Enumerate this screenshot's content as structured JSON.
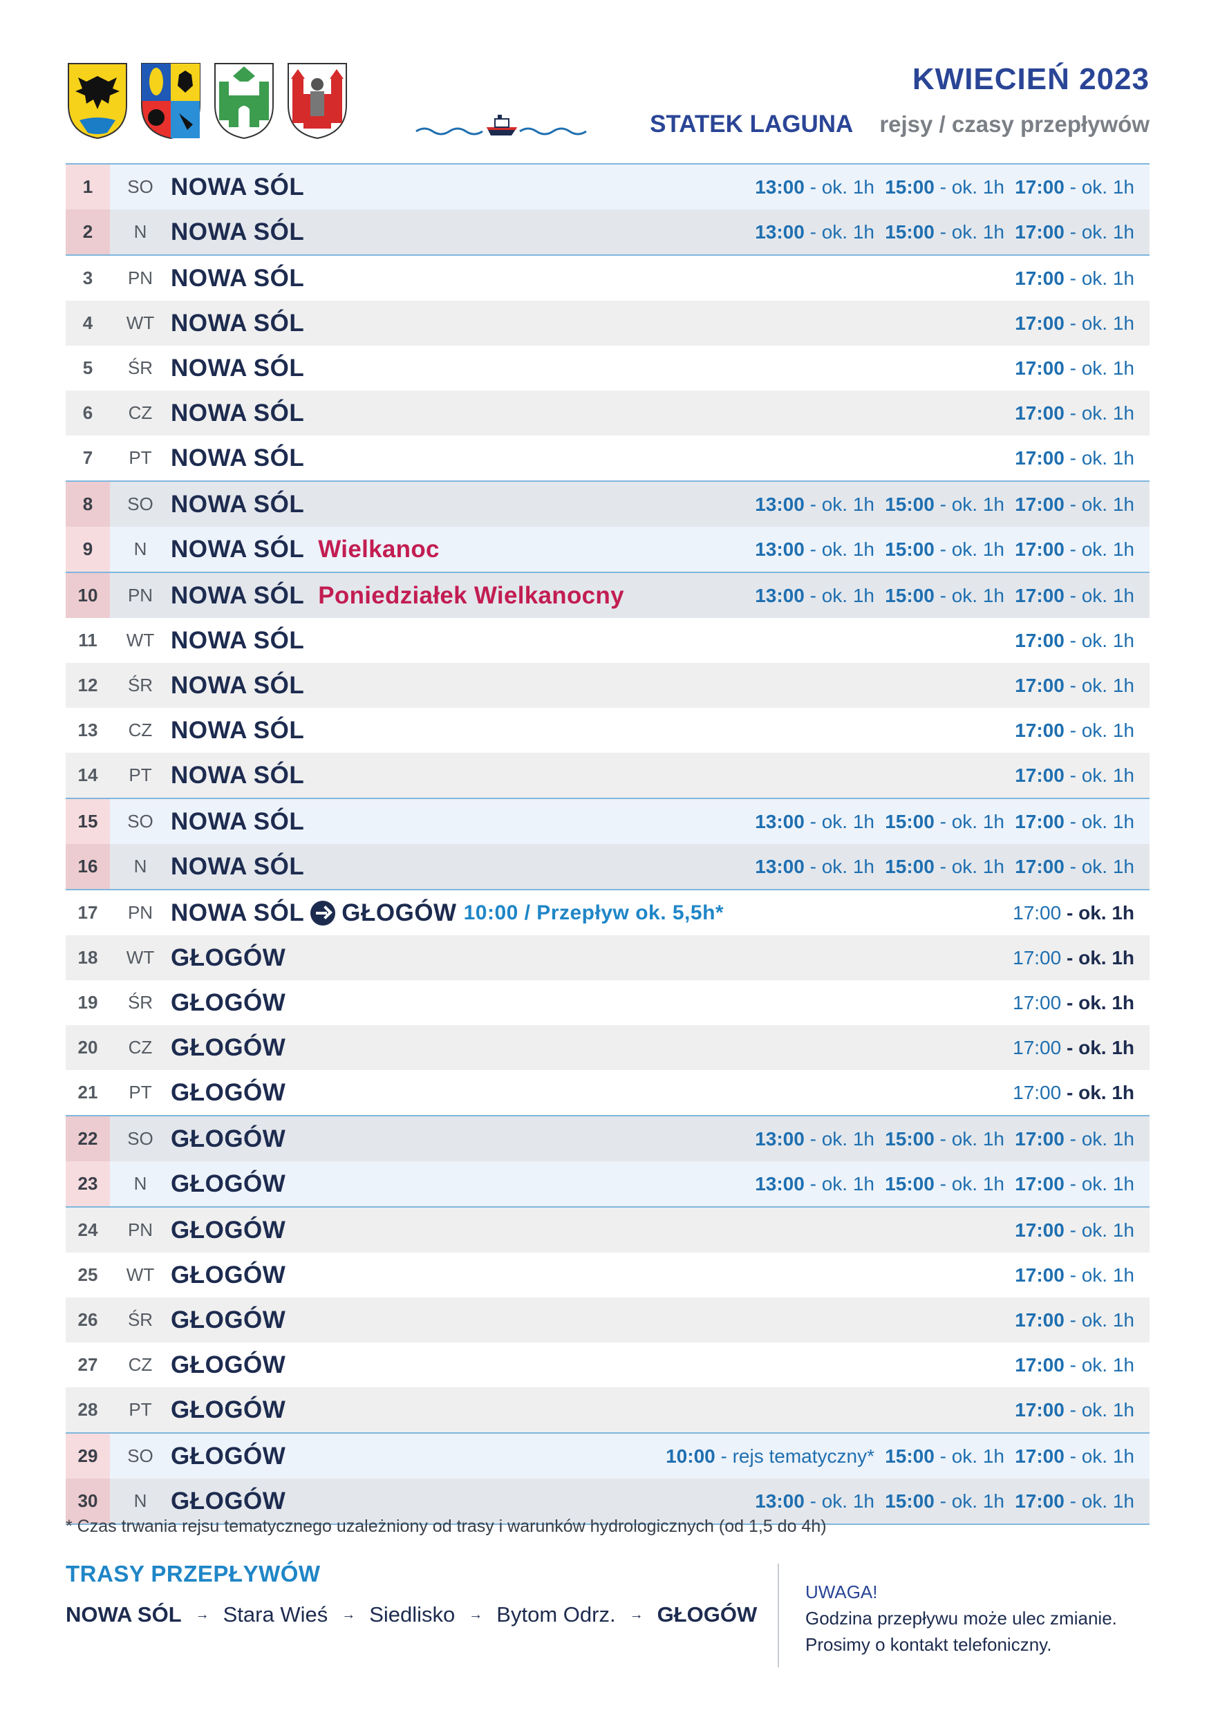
{
  "header": {
    "title": "KWIECIEŃ 2023",
    "ship": "STATEK LAGUNA",
    "subtitle": "rejsy / czasy przepływów"
  },
  "schedule": [
    {
      "day": "1",
      "dow": "SO",
      "place": "NOWA SÓL",
      "weekend": true,
      "times": [
        {
          "t": "13:00",
          "d": "- ok. 1h"
        },
        {
          "t": "15:00",
          "d": "- ok. 1h"
        },
        {
          "t": "17:00",
          "d": "- ok. 1h"
        }
      ]
    },
    {
      "day": "2",
      "dow": "N",
      "place": "NOWA SÓL",
      "weekend": true,
      "times": [
        {
          "t": "13:00",
          "d": "- ok. 1h"
        },
        {
          "t": "15:00",
          "d": "- ok. 1h"
        },
        {
          "t": "17:00",
          "d": "- ok. 1h"
        }
      ]
    },
    {
      "day": "3",
      "dow": "PN",
      "place": "NOWA SÓL",
      "times": [
        {
          "t": "17:00",
          "d": "- ok. 1h"
        }
      ]
    },
    {
      "day": "4",
      "dow": "WT",
      "place": "NOWA SÓL",
      "times": [
        {
          "t": "17:00",
          "d": "- ok. 1h"
        }
      ]
    },
    {
      "day": "5",
      "dow": "ŚR",
      "place": "NOWA SÓL",
      "times": [
        {
          "t": "17:00",
          "d": "- ok. 1h"
        }
      ]
    },
    {
      "day": "6",
      "dow": "CZ",
      "place": "NOWA SÓL",
      "times": [
        {
          "t": "17:00",
          "d": "- ok. 1h"
        }
      ]
    },
    {
      "day": "7",
      "dow": "PT",
      "place": "NOWA SÓL",
      "times": [
        {
          "t": "17:00",
          "d": "- ok. 1h"
        }
      ]
    },
    {
      "day": "8",
      "dow": "SO",
      "place": "NOWA SÓL",
      "weekend": true,
      "times": [
        {
          "t": "13:00",
          "d": "- ok. 1h"
        },
        {
          "t": "15:00",
          "d": "- ok. 1h"
        },
        {
          "t": "17:00",
          "d": "- ok. 1h"
        }
      ]
    },
    {
      "day": "9",
      "dow": "N",
      "place": "NOWA SÓL",
      "holiday": "Wielkanoc",
      "weekend": true,
      "times": [
        {
          "t": "13:00",
          "d": "- ok. 1h"
        },
        {
          "t": "15:00",
          "d": "- ok. 1h"
        },
        {
          "t": "17:00",
          "d": "- ok. 1h"
        }
      ]
    },
    {
      "day": "10",
      "dow": "PN",
      "place": "NOWA SÓL",
      "holiday": "Poniedziałek Wielkanocny",
      "weekend": true,
      "times": [
        {
          "t": "13:00",
          "d": "- ok. 1h"
        },
        {
          "t": "15:00",
          "d": "- ok. 1h"
        },
        {
          "t": "17:00",
          "d": "- ok. 1h"
        }
      ]
    },
    {
      "day": "11",
      "dow": "WT",
      "place": "NOWA SÓL",
      "times": [
        {
          "t": "17:00",
          "d": "- ok. 1h"
        }
      ]
    },
    {
      "day": "12",
      "dow": "ŚR",
      "place": "NOWA SÓL",
      "times": [
        {
          "t": "17:00",
          "d": "- ok. 1h"
        }
      ]
    },
    {
      "day": "13",
      "dow": "CZ",
      "place": "NOWA SÓL",
      "times": [
        {
          "t": "17:00",
          "d": "- ok. 1h"
        }
      ]
    },
    {
      "day": "14",
      "dow": "PT",
      "place": "NOWA SÓL",
      "times": [
        {
          "t": "17:00",
          "d": "- ok. 1h"
        }
      ]
    },
    {
      "day": "15",
      "dow": "SO",
      "place": "NOWA SÓL",
      "weekend": true,
      "times": [
        {
          "t": "13:00",
          "d": "- ok. 1h"
        },
        {
          "t": "15:00",
          "d": "- ok. 1h"
        },
        {
          "t": "17:00",
          "d": "- ok. 1h"
        }
      ]
    },
    {
      "day": "16",
      "dow": "N",
      "place": "NOWA SÓL",
      "weekend": true,
      "times": [
        {
          "t": "13:00",
          "d": "- ok. 1h"
        },
        {
          "t": "15:00",
          "d": "- ok. 1h"
        },
        {
          "t": "17:00",
          "d": "- ok. 1h"
        }
      ]
    },
    {
      "day": "17",
      "dow": "PN",
      "place": "NOWA SÓL",
      "destination": "GŁOGÓW",
      "transfer": "10:00 / Przepływ ok. 5,5h*",
      "times": [
        {
          "t": "17:00",
          "d": "- ok. 1h",
          "style": "bold-dur"
        }
      ]
    },
    {
      "day": "18",
      "dow": "WT",
      "place": "GŁOGÓW",
      "times": [
        {
          "t": "17:00",
          "d": "- ok. 1h",
          "style": "bold-dur"
        }
      ]
    },
    {
      "day": "19",
      "dow": "ŚR",
      "place": "GŁOGÓW",
      "times": [
        {
          "t": "17:00",
          "d": "- ok. 1h",
          "style": "bold-dur"
        }
      ]
    },
    {
      "day": "20",
      "dow": "CZ",
      "place": "GŁOGÓW",
      "times": [
        {
          "t": "17:00",
          "d": "- ok. 1h",
          "style": "bold-dur"
        }
      ]
    },
    {
      "day": "21",
      "dow": "PT",
      "place": "GŁOGÓW",
      "times": [
        {
          "t": "17:00",
          "d": "- ok. 1h",
          "style": "bold-dur"
        }
      ]
    },
    {
      "day": "22",
      "dow": "SO",
      "place": "GŁOGÓW",
      "weekend": true,
      "times": [
        {
          "t": "13:00",
          "d": "- ok. 1h"
        },
        {
          "t": "15:00",
          "d": "- ok. 1h"
        },
        {
          "t": "17:00",
          "d": "- ok. 1h"
        }
      ]
    },
    {
      "day": "23",
      "dow": "N",
      "place": "GŁOGÓW",
      "weekend": true,
      "times": [
        {
          "t": "13:00",
          "d": "- ok. 1h"
        },
        {
          "t": "15:00",
          "d": "- ok. 1h"
        },
        {
          "t": "17:00",
          "d": "- ok. 1h"
        }
      ]
    },
    {
      "day": "24",
      "dow": "PN",
      "place": "GŁOGÓW",
      "times": [
        {
          "t": "17:00",
          "d": "- ok. 1h"
        }
      ]
    },
    {
      "day": "25",
      "dow": "WT",
      "place": "GŁOGÓW",
      "times": [
        {
          "t": "17:00",
          "d": "- ok. 1h"
        }
      ]
    },
    {
      "day": "26",
      "dow": "ŚR",
      "place": "GŁOGÓW",
      "times": [
        {
          "t": "17:00",
          "d": "- ok. 1h"
        }
      ]
    },
    {
      "day": "27",
      "dow": "CZ",
      "place": "GŁOGÓW",
      "times": [
        {
          "t": "17:00",
          "d": "- ok. 1h"
        }
      ]
    },
    {
      "day": "28",
      "dow": "PT",
      "place": "GŁOGÓW",
      "times": [
        {
          "t": "17:00",
          "d": "- ok. 1h"
        }
      ]
    },
    {
      "day": "29",
      "dow": "SO",
      "place": "GŁOGÓW",
      "weekend": true,
      "times": [
        {
          "t": "10:00",
          "d": "- rejs tematyczny*",
          "wide": true
        },
        {
          "t": "15:00",
          "d": "- ok. 1h"
        },
        {
          "t": "17:00",
          "d": "- ok. 1h"
        }
      ]
    },
    {
      "day": "30",
      "dow": "N",
      "place": "GŁOGÓW",
      "weekend": true,
      "times": [
        {
          "t": "13:00",
          "d": "- ok. 1h"
        },
        {
          "t": "15:00",
          "d": "- ok. 1h"
        },
        {
          "t": "17:00",
          "d": "- ok. 1h"
        }
      ]
    }
  ],
  "footnote": "* Czas trwania rejsu tematycznego uzależniony od trasy i warunków hydrologicznych (od 1,5 do 4h)",
  "routes": {
    "title": "TRASY PRZEPŁYWÓW",
    "stops": [
      "NOWA SÓL",
      "Stara Wieś",
      "Siedlisko",
      "Bytom Odrz.",
      "GŁOGÓW"
    ]
  },
  "note": {
    "title": "UWAGA!",
    "line1": "Godzina przepływu może ulec zmianie.",
    "line2": "Prosimy o kontakt telefoniczny."
  },
  "colors": {
    "accent_blue": "#1f86c7",
    "navy": "#1d2b4f",
    "holiday_red": "#c21d52",
    "weekend_num_bg": "#f6dcdf"
  }
}
